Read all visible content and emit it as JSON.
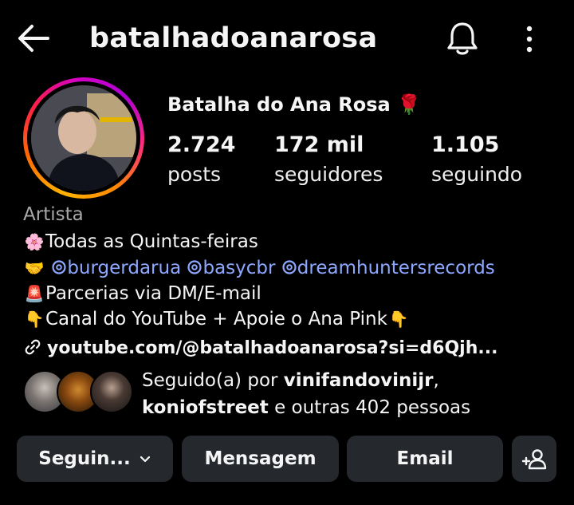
{
  "header": {
    "username": "batalhadoanarosa",
    "back_icon": "arrow-left-icon",
    "bell_icon": "bell-icon",
    "menu_icon": "more-vertical-icon"
  },
  "profile": {
    "display_name": "Batalha do Ana Rosa 🌹",
    "stats": [
      {
        "value": "2.724",
        "label": "posts"
      },
      {
        "value": "172 mil",
        "label": "seguidores"
      },
      {
        "value": "1.105",
        "label": "seguindo"
      }
    ],
    "category": "Artista"
  },
  "bio": {
    "line1_emoji": "🌸",
    "line1_text": "Todas as Quintas-feiras",
    "line2_emoji": "🤝",
    "mentions": [
      "burgerdarua",
      "basycbr",
      "dreamhuntersrecords"
    ],
    "line3_emoji": "🚨",
    "line3_text": "Parcerias via DM/E-mail",
    "line4_emoji_start": "👇",
    "line4_text": "Canal do YouTube + Apoie o Ana Pink",
    "line4_emoji_end": "👇",
    "link": "youtube.com/@batalhadoanarosa?si=d6Qjh..."
  },
  "followed_by": {
    "prefix": "Seguido(a) por ",
    "user1": "vinifandovinijr",
    "separator": ",",
    "user2": "koniofstreet",
    "suffix": " e outras 402 pessoas"
  },
  "actions": {
    "following_label": "Seguin...",
    "message_label": "Mensagem",
    "email_label": "Email",
    "add_user_icon": "add-person-icon"
  },
  "colors": {
    "background": "#000000",
    "button": "#25292e",
    "mention": "#8ea8ff",
    "secondary_text": "#a8a8a8"
  }
}
